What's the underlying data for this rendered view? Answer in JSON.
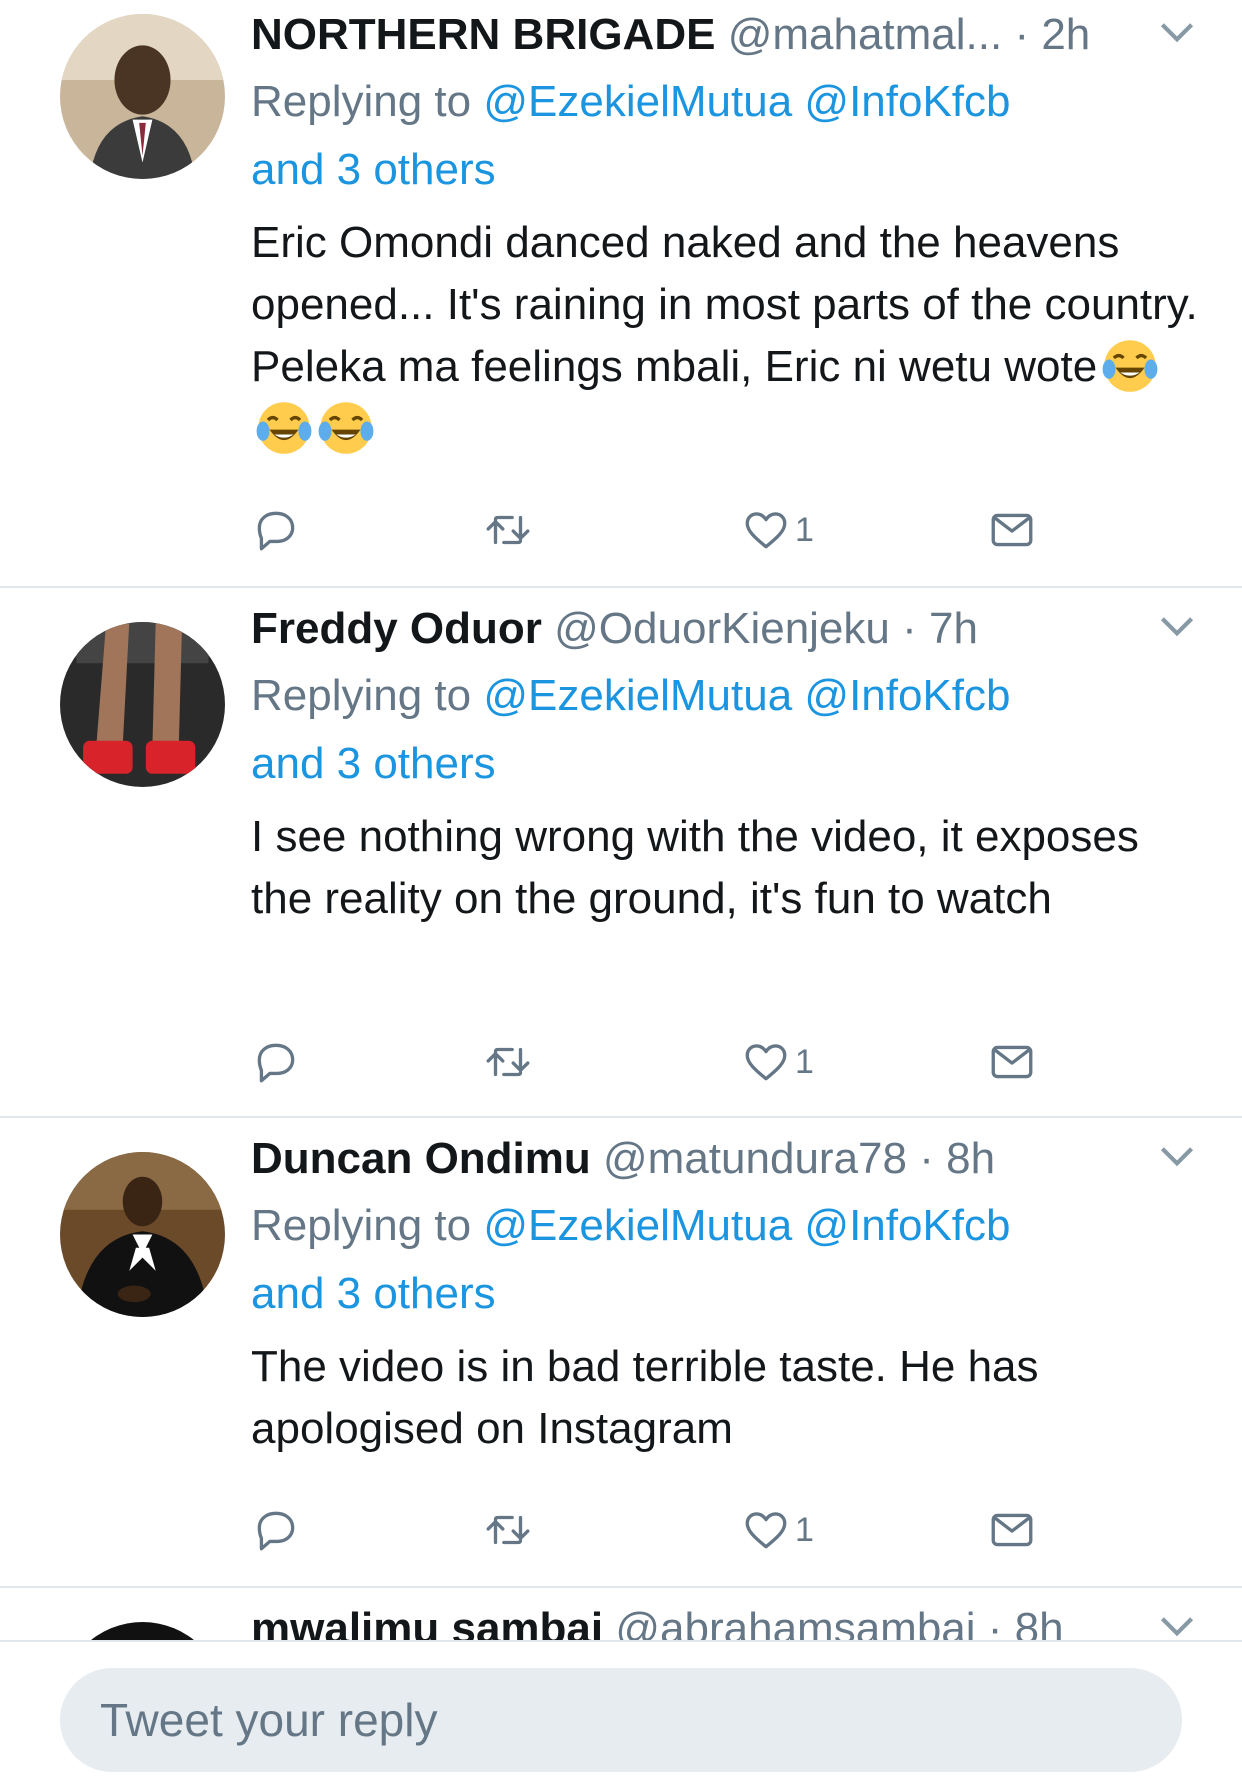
{
  "tweets": [
    {
      "name": "NORTHERN BRIGADE",
      "handle": "@mahatmal...",
      "time": "· 2h",
      "replying_prefix": "Replying to",
      "mention1": "@EzekielMutua",
      "mention2": "@InfoKfcb",
      "others": "and 3 others",
      "text": "Eric Omondi danced naked and the heavens opened... It's raining in most parts of the country. Peleka ma feelings mbali,  Eric ni wetu wote",
      "emoji_count": 3,
      "likes": "1"
    },
    {
      "name": "Freddy Oduor",
      "handle": "@OduorKienjeku",
      "time": "· 7h",
      "replying_prefix": "Replying to",
      "mention1": "@EzekielMutua",
      "mention2": "@InfoKfcb",
      "others": "and 3 others",
      "text": "I see nothing wrong with the video, it exposes the reality on the ground, it's fun to watch",
      "likes": "1"
    },
    {
      "name": "Duncan Ondimu",
      "handle": "@matundura78",
      "time": "· 8h",
      "replying_prefix": "Replying to",
      "mention1": "@EzekielMutua",
      "mention2": "@InfoKfcb",
      "others": "and 3 others",
      "text": "The video is in bad terrible taste. He has apologised on Instagram",
      "likes": "1"
    },
    {
      "name": "mwalimu sambai",
      "handle": "@abrahamsambai",
      "time": "· 8h"
    }
  ],
  "reply_bar": {
    "placeholder": "Tweet your reply"
  },
  "colors": {
    "accent": "#1b95e0",
    "secondary_text": "#657786",
    "divider": "#e1e8ed",
    "input_bg": "#e6ecf0"
  },
  "icons": [
    "reply-icon",
    "retweet-icon",
    "like-icon",
    "direct-message-icon",
    "chevron-down-icon",
    "tears-of-joy-emoji"
  ]
}
